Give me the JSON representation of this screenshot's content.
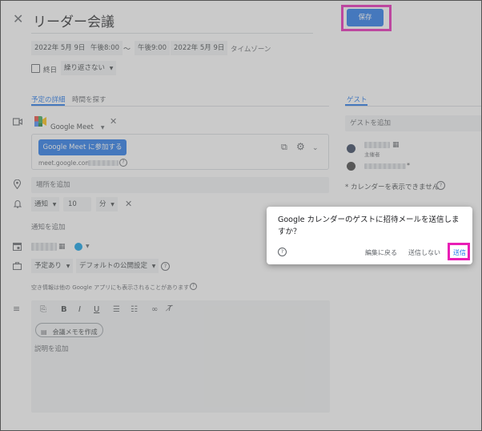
{
  "title": "リーダー会議",
  "save_label": "保存",
  "datetime": {
    "start_date": "2022年 5月 9日",
    "start_time": "午後8:00",
    "separator": "〜",
    "end_time": "午後9:00",
    "end_date": "2022年 5月 9日",
    "timezone": "タイムゾーン"
  },
  "all_day_label": "終日",
  "repeat_label": "繰り返さない",
  "tabs": {
    "details": "予定の詳細",
    "find_time": "時間を探す"
  },
  "meet": {
    "label": "Google Meet",
    "join_button": "Google Meet に参加する",
    "link_prefix": "meet.google.com/"
  },
  "location_placeholder": "場所を追加",
  "notification": {
    "type": "通知",
    "amount": "10",
    "unit": "分"
  },
  "add_notification": "通知を追加",
  "availability": "予定あり",
  "visibility": "デフォルトの公開設定",
  "availability_note": "空き情報は他の Google アプリにも表示されることがあります",
  "meeting_notes_button": "会議メモを作成",
  "description_placeholder": "説明を追加",
  "guests": {
    "tab_label": "ゲスト",
    "add_placeholder": "ゲストを追加",
    "organizer_label": "主催者",
    "calendar_note": "* カレンダーを表示できません"
  },
  "dialog": {
    "message": "Google カレンダーのゲストに招待メールを送信しますか？",
    "back_button": "編集に戻る",
    "dont_send_button": "送信しない",
    "send_button": "送信"
  },
  "colors": {
    "primary": "#1a73e8",
    "highlight": "#e91eb6",
    "event_color": "#039be5"
  }
}
